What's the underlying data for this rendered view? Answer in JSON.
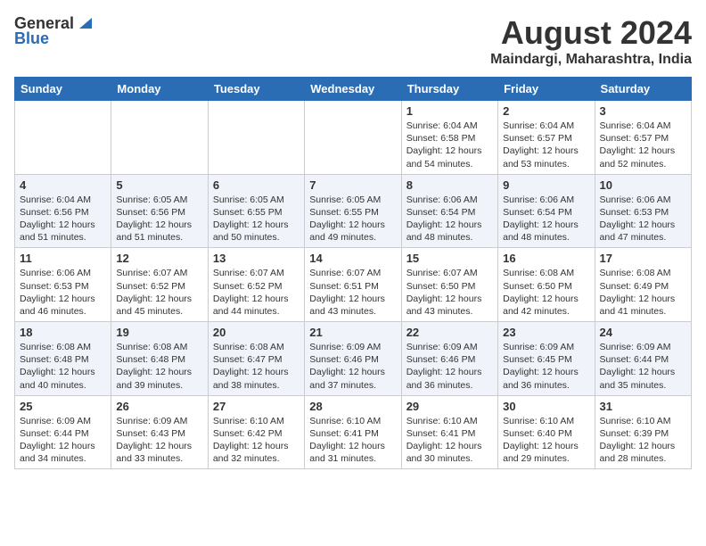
{
  "header": {
    "logo_general": "General",
    "logo_blue": "Blue",
    "month_year": "August 2024",
    "location": "Maindargi, Maharashtra, India"
  },
  "weekdays": [
    "Sunday",
    "Monday",
    "Tuesday",
    "Wednesday",
    "Thursday",
    "Friday",
    "Saturday"
  ],
  "weeks": [
    [
      {
        "day": "",
        "sunrise": "",
        "sunset": "",
        "daylight": ""
      },
      {
        "day": "",
        "sunrise": "",
        "sunset": "",
        "daylight": ""
      },
      {
        "day": "",
        "sunrise": "",
        "sunset": "",
        "daylight": ""
      },
      {
        "day": "",
        "sunrise": "",
        "sunset": "",
        "daylight": ""
      },
      {
        "day": "1",
        "sunrise": "Sunrise: 6:04 AM",
        "sunset": "Sunset: 6:58 PM",
        "daylight": "Daylight: 12 hours and 54 minutes."
      },
      {
        "day": "2",
        "sunrise": "Sunrise: 6:04 AM",
        "sunset": "Sunset: 6:57 PM",
        "daylight": "Daylight: 12 hours and 53 minutes."
      },
      {
        "day": "3",
        "sunrise": "Sunrise: 6:04 AM",
        "sunset": "Sunset: 6:57 PM",
        "daylight": "Daylight: 12 hours and 52 minutes."
      }
    ],
    [
      {
        "day": "4",
        "sunrise": "Sunrise: 6:04 AM",
        "sunset": "Sunset: 6:56 PM",
        "daylight": "Daylight: 12 hours and 51 minutes."
      },
      {
        "day": "5",
        "sunrise": "Sunrise: 6:05 AM",
        "sunset": "Sunset: 6:56 PM",
        "daylight": "Daylight: 12 hours and 51 minutes."
      },
      {
        "day": "6",
        "sunrise": "Sunrise: 6:05 AM",
        "sunset": "Sunset: 6:55 PM",
        "daylight": "Daylight: 12 hours and 50 minutes."
      },
      {
        "day": "7",
        "sunrise": "Sunrise: 6:05 AM",
        "sunset": "Sunset: 6:55 PM",
        "daylight": "Daylight: 12 hours and 49 minutes."
      },
      {
        "day": "8",
        "sunrise": "Sunrise: 6:06 AM",
        "sunset": "Sunset: 6:54 PM",
        "daylight": "Daylight: 12 hours and 48 minutes."
      },
      {
        "day": "9",
        "sunrise": "Sunrise: 6:06 AM",
        "sunset": "Sunset: 6:54 PM",
        "daylight": "Daylight: 12 hours and 48 minutes."
      },
      {
        "day": "10",
        "sunrise": "Sunrise: 6:06 AM",
        "sunset": "Sunset: 6:53 PM",
        "daylight": "Daylight: 12 hours and 47 minutes."
      }
    ],
    [
      {
        "day": "11",
        "sunrise": "Sunrise: 6:06 AM",
        "sunset": "Sunset: 6:53 PM",
        "daylight": "Daylight: 12 hours and 46 minutes."
      },
      {
        "day": "12",
        "sunrise": "Sunrise: 6:07 AM",
        "sunset": "Sunset: 6:52 PM",
        "daylight": "Daylight: 12 hours and 45 minutes."
      },
      {
        "day": "13",
        "sunrise": "Sunrise: 6:07 AM",
        "sunset": "Sunset: 6:52 PM",
        "daylight": "Daylight: 12 hours and 44 minutes."
      },
      {
        "day": "14",
        "sunrise": "Sunrise: 6:07 AM",
        "sunset": "Sunset: 6:51 PM",
        "daylight": "Daylight: 12 hours and 43 minutes."
      },
      {
        "day": "15",
        "sunrise": "Sunrise: 6:07 AM",
        "sunset": "Sunset: 6:50 PM",
        "daylight": "Daylight: 12 hours and 43 minutes."
      },
      {
        "day": "16",
        "sunrise": "Sunrise: 6:08 AM",
        "sunset": "Sunset: 6:50 PM",
        "daylight": "Daylight: 12 hours and 42 minutes."
      },
      {
        "day": "17",
        "sunrise": "Sunrise: 6:08 AM",
        "sunset": "Sunset: 6:49 PM",
        "daylight": "Daylight: 12 hours and 41 minutes."
      }
    ],
    [
      {
        "day": "18",
        "sunrise": "Sunrise: 6:08 AM",
        "sunset": "Sunset: 6:48 PM",
        "daylight": "Daylight: 12 hours and 40 minutes."
      },
      {
        "day": "19",
        "sunrise": "Sunrise: 6:08 AM",
        "sunset": "Sunset: 6:48 PM",
        "daylight": "Daylight: 12 hours and 39 minutes."
      },
      {
        "day": "20",
        "sunrise": "Sunrise: 6:08 AM",
        "sunset": "Sunset: 6:47 PM",
        "daylight": "Daylight: 12 hours and 38 minutes."
      },
      {
        "day": "21",
        "sunrise": "Sunrise: 6:09 AM",
        "sunset": "Sunset: 6:46 PM",
        "daylight": "Daylight: 12 hours and 37 minutes."
      },
      {
        "day": "22",
        "sunrise": "Sunrise: 6:09 AM",
        "sunset": "Sunset: 6:46 PM",
        "daylight": "Daylight: 12 hours and 36 minutes."
      },
      {
        "day": "23",
        "sunrise": "Sunrise: 6:09 AM",
        "sunset": "Sunset: 6:45 PM",
        "daylight": "Daylight: 12 hours and 36 minutes."
      },
      {
        "day": "24",
        "sunrise": "Sunrise: 6:09 AM",
        "sunset": "Sunset: 6:44 PM",
        "daylight": "Daylight: 12 hours and 35 minutes."
      }
    ],
    [
      {
        "day": "25",
        "sunrise": "Sunrise: 6:09 AM",
        "sunset": "Sunset: 6:44 PM",
        "daylight": "Daylight: 12 hours and 34 minutes."
      },
      {
        "day": "26",
        "sunrise": "Sunrise: 6:09 AM",
        "sunset": "Sunset: 6:43 PM",
        "daylight": "Daylight: 12 hours and 33 minutes."
      },
      {
        "day": "27",
        "sunrise": "Sunrise: 6:10 AM",
        "sunset": "Sunset: 6:42 PM",
        "daylight": "Daylight: 12 hours and 32 minutes."
      },
      {
        "day": "28",
        "sunrise": "Sunrise: 6:10 AM",
        "sunset": "Sunset: 6:41 PM",
        "daylight": "Daylight: 12 hours and 31 minutes."
      },
      {
        "day": "29",
        "sunrise": "Sunrise: 6:10 AM",
        "sunset": "Sunset: 6:41 PM",
        "daylight": "Daylight: 12 hours and 30 minutes."
      },
      {
        "day": "30",
        "sunrise": "Sunrise: 6:10 AM",
        "sunset": "Sunset: 6:40 PM",
        "daylight": "Daylight: 12 hours and 29 minutes."
      },
      {
        "day": "31",
        "sunrise": "Sunrise: 6:10 AM",
        "sunset": "Sunset: 6:39 PM",
        "daylight": "Daylight: 12 hours and 28 minutes."
      }
    ]
  ]
}
